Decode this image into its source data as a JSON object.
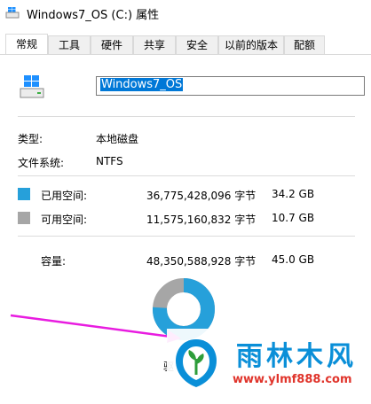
{
  "window": {
    "title": "Windows7_OS (C:) 属性"
  },
  "tabs": [
    {
      "label": "常规"
    },
    {
      "label": "工具"
    },
    {
      "label": "硬件"
    },
    {
      "label": "共享"
    },
    {
      "label": "安全"
    },
    {
      "label": "以前的版本"
    },
    {
      "label": "配额"
    }
  ],
  "drive": {
    "name_value": "Windows7_OS"
  },
  "info": {
    "type_label": "类型:",
    "type_value": "本地磁盘",
    "fs_label": "文件系统:",
    "fs_value": "NTFS"
  },
  "space": {
    "used": {
      "label": "已用空间:",
      "bytes": "36,775,428,096 字节",
      "gb": "34.2 GB",
      "color": "#26a0da"
    },
    "free": {
      "label": "可用空间:",
      "bytes": "11,575,160,832 字节",
      "gb": "10.7 GB",
      "color": "#a6a6a6"
    },
    "capacity": {
      "label": "容量:",
      "bytes": "48,350,588,928 字节",
      "gb": "45.0 GB"
    },
    "used_fraction": 0.76
  },
  "drive_label_partial": "驱",
  "watermark": {
    "title": "雨林木风",
    "url": "www.ylmf888.com"
  },
  "colors": {
    "arrow": "#e81ce0",
    "selection": "#0078d7"
  }
}
